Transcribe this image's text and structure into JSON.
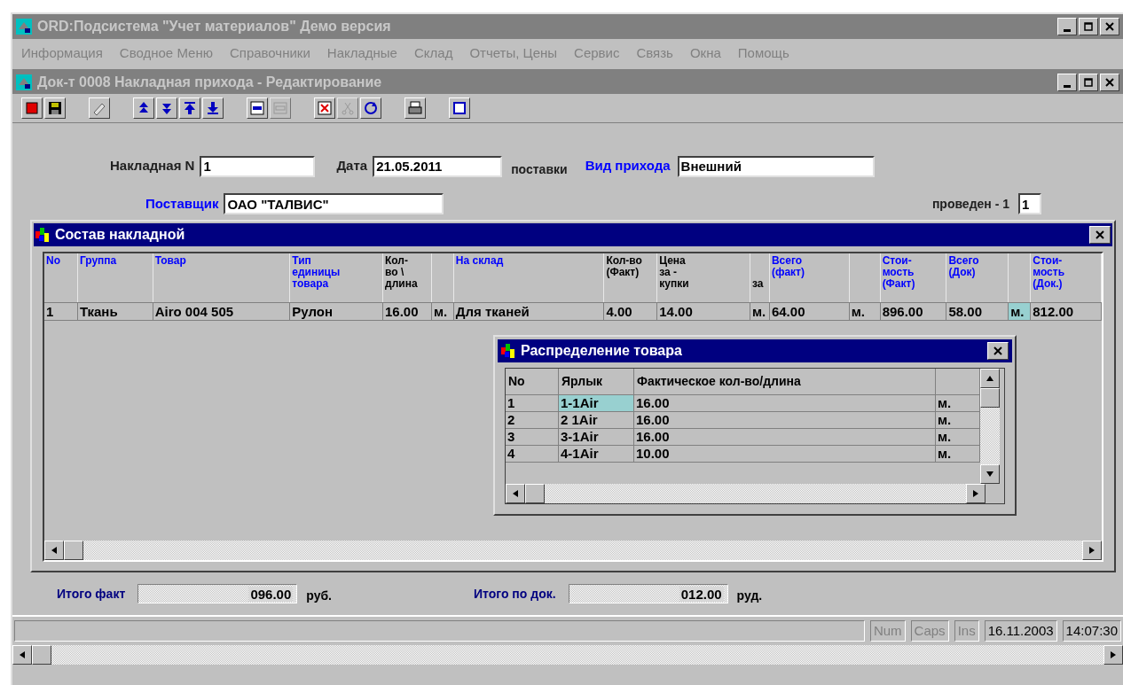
{
  "window": {
    "title": "ORD:Подсистема \"Учет материалов\" Демо версия"
  },
  "menu": [
    {
      "label": "Информация",
      "disabled": true
    },
    {
      "label": "Сводное Меню",
      "disabled": true
    },
    {
      "label": "Справочники",
      "disabled": true
    },
    {
      "label": "Накладные",
      "disabled": true
    },
    {
      "label": "Склад",
      "disabled": true
    },
    {
      "label": "Отчеты, Цены",
      "disabled": true
    },
    {
      "label": "Сервис",
      "disabled": true
    },
    {
      "label": "Связь",
      "disabled": true
    },
    {
      "label": "Окна",
      "disabled": true
    },
    {
      "label": "Помощь",
      "disabled": true
    }
  ],
  "document": {
    "title": "Док-т 0008 Накладная прихода - Редактирование"
  },
  "toolbar": [
    [
      {
        "disabled": false
      },
      {
        "disabled": false
      }
    ],
    [
      {
        "disabled": false
      }
    ],
    [
      {
        "disabled": false
      },
      {
        "disabled": false
      },
      {
        "disabled": false
      },
      {
        "disabled": false
      }
    ],
    [
      {
        "disabled": false
      },
      {
        "disabled": true
      }
    ],
    [
      {
        "disabled": false
      },
      {
        "disabled": true
      },
      {
        "disabled": false
      }
    ],
    [
      {
        "disabled": false
      }
    ],
    [
      {
        "disabled": false
      }
    ]
  ],
  "form": {
    "invoice_number": {
      "label": "Накладная N",
      "value": "1"
    },
    "date": {
      "label": "Дата",
      "value": "21.05.2011",
      "suffix": "поставки"
    },
    "income_type": {
      "label": "Вид прихода",
      "value": "Внешний"
    },
    "supplier": {
      "label": "Поставщик",
      "value": "ОАО \"ТАЛВИС\""
    },
    "posted": {
      "label": "проведен - 1",
      "value": "1"
    }
  },
  "grid": {
    "title": "Состав накладной",
    "columns": [
      {
        "label": "No",
        "accent": true
      },
      {
        "label": "Группа",
        "accent": true
      },
      {
        "label": "Товар",
        "accent": true
      },
      {
        "label": "Тип\nединицы\nтовара",
        "accent": true
      },
      {
        "label": "Кол-\nво \\\nдлина",
        "accent": false
      },
      {},
      {
        "label": "На склад",
        "accent": true
      },
      {
        "label": "Кол-во\n(Факт)",
        "accent": false
      },
      {
        "label": "Цена\nза -\nкупки",
        "accent": false
      },
      {
        "label": "\n\nза",
        "accent": false
      },
      {
        "label": "Всего\n(факт)",
        "accent": true
      },
      {},
      {
        "label": "Стои-\nмость\n(Факт)",
        "accent": true
      },
      {
        "label": "Всего\n(Док)",
        "accent": true
      },
      {},
      {
        "label": "Стои-\nмость\n(Док.)",
        "accent": true
      }
    ],
    "rows": [
      {
        "cells": [
          {
            "text": "1",
            "selected": false
          },
          {
            "text": "Ткань",
            "selected": false
          },
          {
            "text": "Airo 004 505",
            "selected": false
          },
          {
            "text": "Рулон",
            "selected": false
          },
          {
            "text": "16.00",
            "selected": false
          },
          {
            "text": "м.",
            "selected": false
          },
          {
            "text": "Для тканей",
            "selected": false
          },
          {
            "text": "4.00",
            "selected": false
          },
          {
            "text": "14.00",
            "selected": false
          },
          {
            "text": "м.",
            "selected": false
          },
          {
            "text": "64.00",
            "selected": false
          },
          {
            "text": "м.",
            "selected": false
          },
          {
            "text": "896.00",
            "selected": false
          },
          {
            "text": "58.00",
            "selected": false
          },
          {
            "text": "м.",
            "selected": true
          },
          {
            "text": "812.00",
            "selected": false
          }
        ]
      }
    ]
  },
  "popup": {
    "title": "Распределение товара",
    "columns": [
      "No",
      "Ярлык",
      "Фактическое кол-во/длина"
    ],
    "rows": [
      {
        "cells": [
          {
            "text": "1",
            "selected": false
          },
          {
            "text": "1-1Air",
            "selected": true
          },
          {
            "text": "16.00",
            "selected": false
          },
          {
            "text": "м.",
            "selected": false
          }
        ]
      },
      {
        "cells": [
          {
            "text": "2",
            "selected": false
          },
          {
            "text": "2 1Air",
            "selected": false
          },
          {
            "text": "16.00",
            "selected": false
          },
          {
            "text": "м.",
            "selected": false
          }
        ]
      },
      {
        "cells": [
          {
            "text": "3",
            "selected": false
          },
          {
            "text": "3-1Air",
            "selected": false
          },
          {
            "text": "16.00",
            "selected": false
          },
          {
            "text": "м.",
            "selected": false
          }
        ]
      },
      {
        "cells": [
          {
            "text": "4",
            "selected": false
          },
          {
            "text": "4-1Air",
            "selected": false
          },
          {
            "text": "10.00",
            "selected": false
          },
          {
            "text": "м.",
            "selected": false
          }
        ]
      }
    ]
  },
  "totals": [
    {
      "label": "Итого факт",
      "value": "096.00",
      "unit": "руб."
    },
    {
      "label": "Итого по док.",
      "value": "012.00",
      "unit": "руд."
    }
  ],
  "status_bar": [
    {
      "text": "Num",
      "disabled": true
    },
    {
      "text": "Caps",
      "disabled": true
    },
    {
      "text": "Ins",
      "disabled": true
    },
    {
      "text": "16.11.2003",
      "disabled": false
    },
    {
      "text": "14:07:30",
      "disabled": false
    }
  ]
}
